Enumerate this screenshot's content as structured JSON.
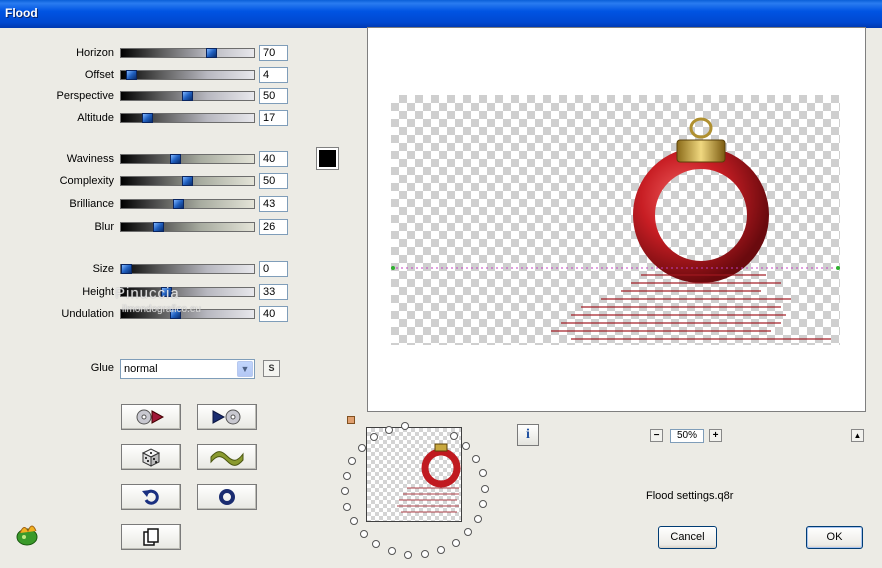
{
  "window": {
    "title": "Flood"
  },
  "sliders": [
    {
      "key": "horizon",
      "label": "Horizon",
      "value": "70",
      "fraction": 0.7
    },
    {
      "key": "offset",
      "label": "Offset",
      "value": "4",
      "fraction": 0.04
    },
    {
      "key": "perspective",
      "label": "Perspective",
      "value": "50",
      "fraction": 0.5
    },
    {
      "key": "altitude",
      "label": "Altitude",
      "value": "17",
      "fraction": 0.17
    },
    {
      "key": "waviness",
      "label": "Waviness",
      "value": "40",
      "fraction": 0.4
    },
    {
      "key": "complexity",
      "label": "Complexity",
      "value": "50",
      "fraction": 0.5
    },
    {
      "key": "brilliance",
      "label": "Brilliance",
      "value": "43",
      "fraction": 0.43
    },
    {
      "key": "blur",
      "label": "Blur",
      "value": "26",
      "fraction": 0.26
    },
    {
      "key": "size",
      "label": "Size",
      "value": "0",
      "fraction": 0.0
    },
    {
      "key": "height",
      "label": "Height",
      "value": "33",
      "fraction": 0.33
    },
    {
      "key": "undulation",
      "label": "Undulation",
      "value": "40",
      "fraction": 0.4
    }
  ],
  "color_swatch": {
    "color": "#000000"
  },
  "glue": {
    "label": "Glue",
    "value": "normal",
    "side_button": "S"
  },
  "tool_buttons": [
    {
      "name": "previous-preset-button",
      "icon": "record-back-icon"
    },
    {
      "name": "next-preset-button",
      "icon": "record-forward-icon"
    },
    {
      "name": "randomize-button",
      "icon": "dice-icon"
    },
    {
      "name": "wave-button",
      "icon": "wave-icon"
    },
    {
      "name": "undo-button",
      "icon": "undo-icon"
    },
    {
      "name": "reset-button",
      "icon": "ring-icon"
    },
    {
      "name": "copy-button",
      "icon": "copy-icon"
    }
  ],
  "watermark": {
    "line1": "Pinuccia",
    "line2": "ilmondografico.eu"
  },
  "zoom": {
    "value": "50%",
    "minus": "−",
    "plus": "+"
  },
  "info_button": {
    "label": "i"
  },
  "collapse_button": {
    "label": "▲"
  },
  "settings_file": "Flood settings.q8r",
  "buttons": {
    "cancel": "Cancel",
    "ok": "OK"
  }
}
